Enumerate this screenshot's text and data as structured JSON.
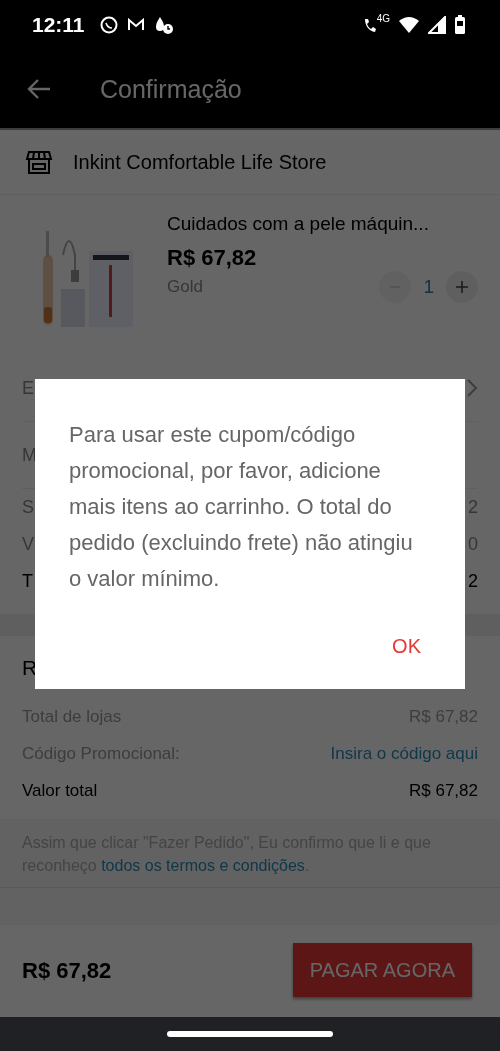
{
  "status_bar": {
    "time": "12:11",
    "network": "4G"
  },
  "header": {
    "title": "Confirmação"
  },
  "store": {
    "name": "Inkint Comfortable Life Store"
  },
  "product": {
    "name": "Cuidados com a pele máquin...",
    "price": "R$ 67,82",
    "variant": "Gold",
    "quantity": "1"
  },
  "covered_rows": [
    {
      "label": "E",
      "kind": "nav"
    },
    {
      "label": "M",
      "kind": "option"
    },
    {
      "label": "S",
      "value": "2",
      "kind": "amount"
    },
    {
      "label": "V",
      "value": "0",
      "kind": "amount"
    },
    {
      "label": "T",
      "value": "2",
      "kind": "total"
    }
  ],
  "summary": {
    "title": "R",
    "rows": [
      {
        "label": "Total de lojas",
        "value": "R$ 67,82",
        "kind": "plain"
      },
      {
        "label": "Código Promocional:",
        "value": "Insira o código aqui",
        "kind": "link"
      },
      {
        "label": "Valor total",
        "value": "R$ 67,82",
        "kind": "total"
      }
    ],
    "terms": "Assim que clicar \"Fazer Pedido\", Eu confirmo que li e que reconheço ",
    "terms_link": "todos os termos e condições",
    "terms_end": "."
  },
  "footer": {
    "total": "R$ 67,82",
    "button": "PAGAR AGORA"
  },
  "dialog": {
    "message": "Para usar este cupom/código promocional, por favor, adicione mais itens ao carrinho. O total do pedido (excluindo frete) não atingiu o valor mínimo.",
    "button": "OK"
  }
}
